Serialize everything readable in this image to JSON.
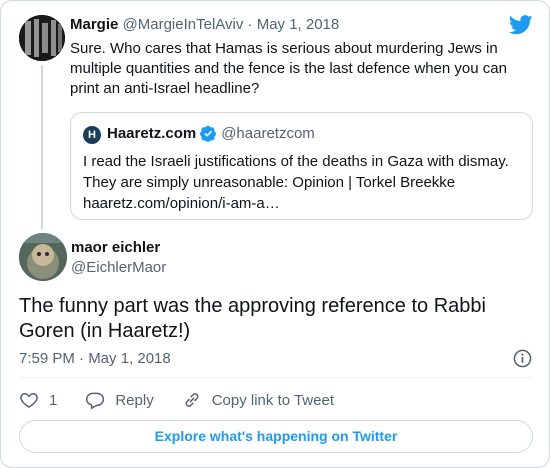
{
  "quoted_context": {
    "author_name": "Margie",
    "author_handle": "@MargieInTelAviv",
    "date": "· May 1, 2018",
    "text": "Sure. Who cares that Hamas is serious about murdering Jews in multiple quantities and the fence is the last defence when you can print an anti-Israel headline?",
    "quote": {
      "logo_letter": "H",
      "author_name": "Haaretz.com",
      "author_handle": "@haaretzcom",
      "text": "I read the Israeli justifications of the deaths in Gaza with dismay. They are simply unreasonable: Opinion | Torkel Breekke haaretz.com/opinion/i-am-a…"
    }
  },
  "tweet": {
    "author_name": "maor eichler",
    "author_handle": "@EichlerMaor",
    "text": "The funny part was the approving reference to Rabbi Goren (in Haaretz!)",
    "timestamp": "7:59 PM · May 1, 2018"
  },
  "actions": {
    "like_count": "1",
    "reply_label": "Reply",
    "copy_link_label": "Copy link to Tweet"
  },
  "explore_label": "Explore what's happening on Twitter",
  "colors": {
    "accent": "#1d9bf0",
    "text": "#0f1419",
    "muted": "#536471",
    "border": "#cfd9de"
  },
  "icons": [
    "twitter-bird-icon",
    "verified-badge-icon",
    "info-icon",
    "heart-icon",
    "reply-icon",
    "link-icon"
  ]
}
